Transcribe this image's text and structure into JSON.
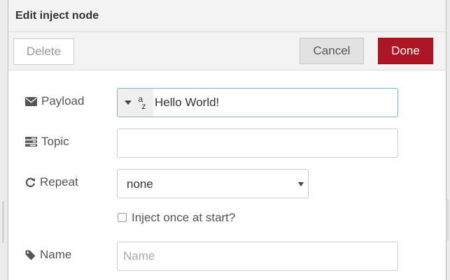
{
  "dialog": {
    "title": "Edit inject node"
  },
  "toolbar": {
    "delete_label": "Delete",
    "cancel_label": "Cancel",
    "done_label": "Done"
  },
  "form": {
    "payload": {
      "label": "Payload",
      "type_icon": "az-string-icon",
      "value": "Hello World!"
    },
    "topic": {
      "label": "Topic",
      "value": ""
    },
    "repeat": {
      "label": "Repeat",
      "selected": "none"
    },
    "inject_once": {
      "label": "Inject once at start?",
      "checked": false
    },
    "name": {
      "label": "Name",
      "placeholder": "Name",
      "value": ""
    }
  },
  "colors": {
    "done_button": "#ad1625",
    "focus_border": "#86aed1",
    "label_text": "#555555"
  }
}
